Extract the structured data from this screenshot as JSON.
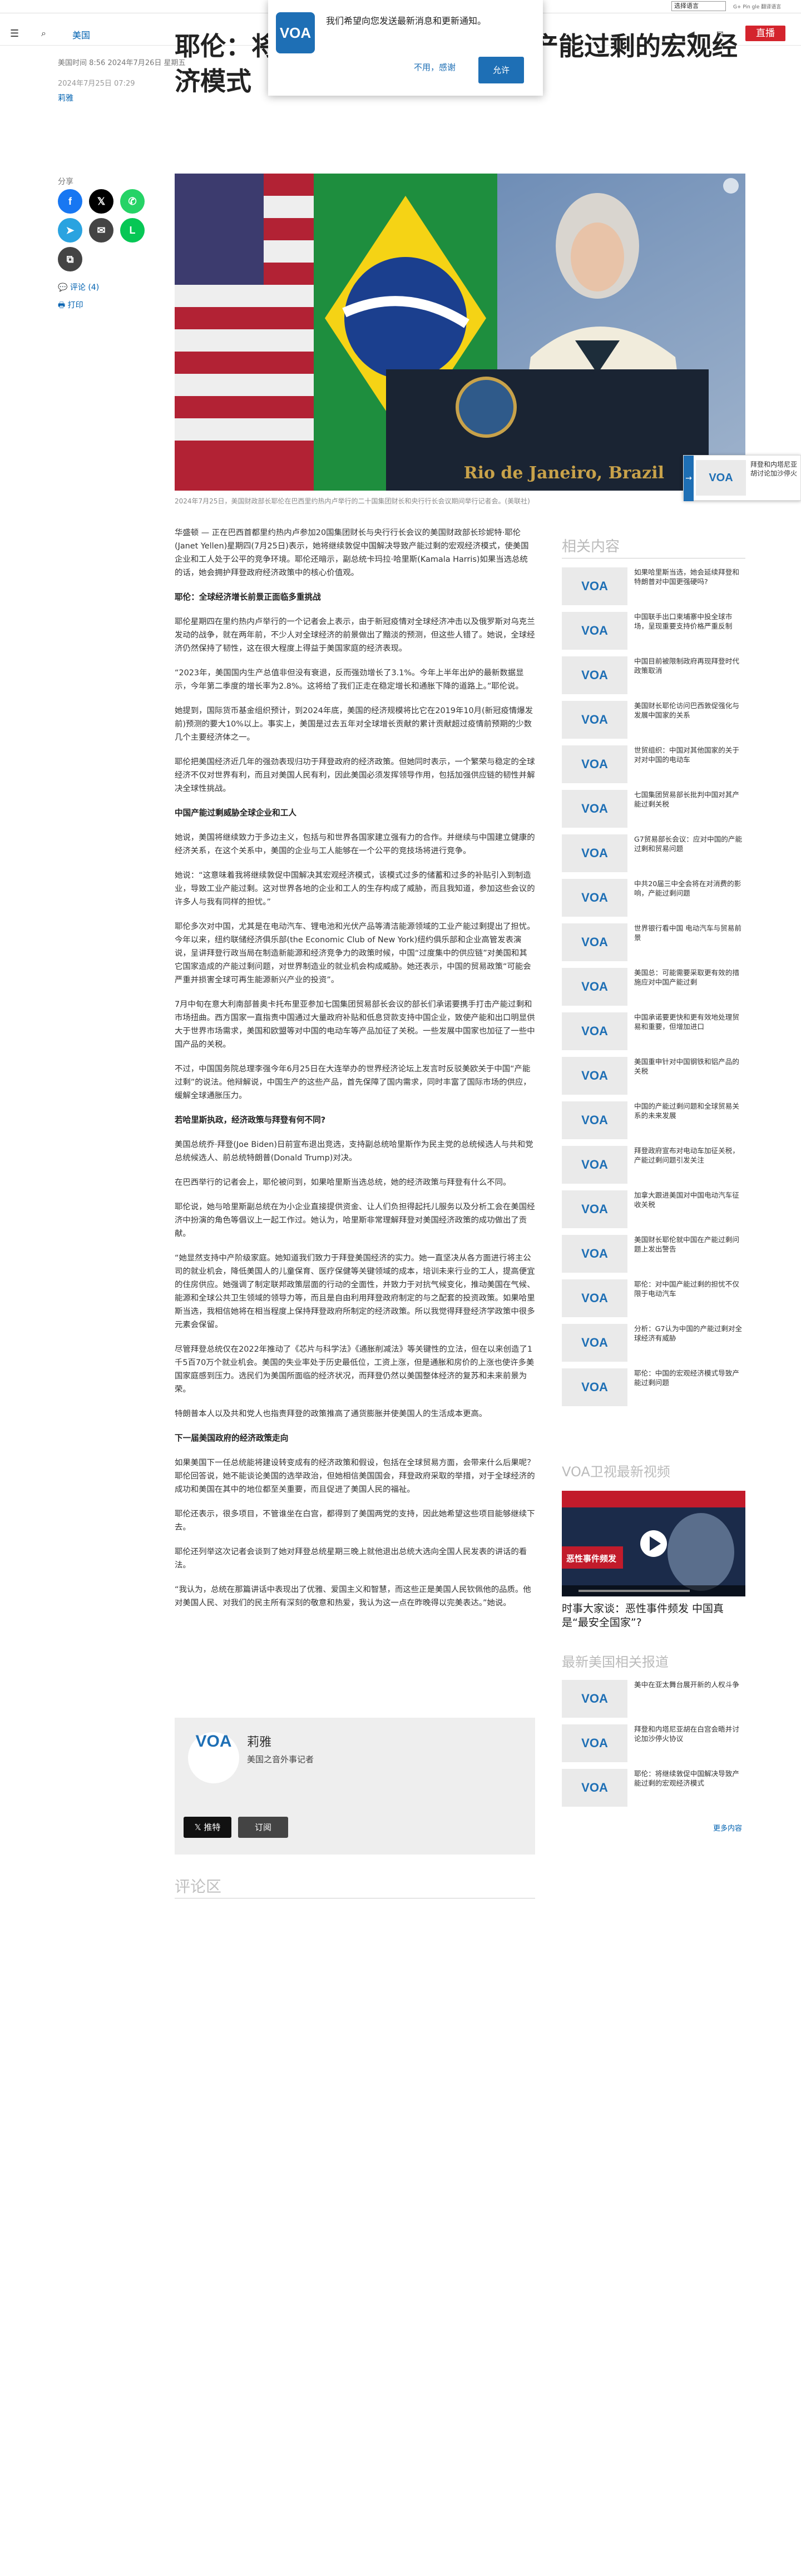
{
  "util": {
    "lang_select": "选择语言",
    "gplus_hint": "G+ Pin gle 翻译语言"
  },
  "header": {
    "section": "美国",
    "live": "直播",
    "menu_icon": "hamburger-icon",
    "search_icon": "search-icon"
  },
  "notification": {
    "logo": "VOA",
    "message": "我们希望向您发送最新消息和更新通知。",
    "decline": "不用，感谢",
    "accept": "允许"
  },
  "article": {
    "date_line": "美国时间 8:56 2024年7月26日 星期五",
    "published": "2024年7月25日 07:29",
    "author": "莉雅",
    "headline": "耶伦：将继续敦促中国解决导致产能过剩的宏观经济模式",
    "photo_text": "Rio de Janeiro, Brazil",
    "caption": "2024年7月25日，美国财政部长耶伦在巴西里约热内卢举行的二十国集团财长和央行行长会议期间举行记者会。(美联社)",
    "paragraphs": [
      {
        "type": "p",
        "text": "华盛顿 — 正在巴西首都里约热内卢参加20国集团财长与央行行长会议的美国财政部长珍妮特·耶伦(Janet Yellen)星期四(7月25日)表示，她将继续敦促中国解决导致产能过剩的宏观经济模式，使美国企业和工人处于公平的竞争环境。耶伦还暗示，副总统卡玛拉·哈里斯(Kamala Harris)如果当选总统的话，她会拥护拜登政府经济政策中的核心价值观。"
      },
      {
        "type": "h",
        "text": "耶伦：全球经济增长前景正面临多重挑战"
      },
      {
        "type": "p",
        "text": "耶伦星期四在里约热内卢举行的一个记者会上表示，由于新冠疫情对全球经济冲击以及俄罗斯对乌克兰发动的战争，就在两年前，不少人对全球经济的前景做出了黯淡的预测，但这些人错了。她说，全球经济仍然保持了韧性，这在很大程度上得益于美国家庭的经济表现。"
      },
      {
        "type": "p",
        "text": "“2023年，美国国内生产总值非但没有衰退，反而强劲增长了3.1%。今年上半年出炉的最新数据显示，今年第二季度的增长率为2.8%。这将给了我们正走在稳定增长和通胀下降的道路上。”耶伦说。"
      },
      {
        "type": "p",
        "text": "她提到，国际货币基金组织预计，到2024年底，美国的经济规模将比它在2019年10月(新冠疫情爆发前)预测的要大10%以上。事实上，美国是过去五年对全球增长贡献的累计贡献超过疫情前预期的少数几个主要经济体之一。"
      },
      {
        "type": "p",
        "text": "耶伦把美国经济近几年的强劲表现归功于拜登政府的经济政策。但她同时表示，一个繁荣与稳定的全球经济不仅对世界有利，而且对美国人民有利，因此美国必须发挥领导作用，包括加强供应链的韧性并解决全球性挑战。"
      },
      {
        "type": "h",
        "text": "中国产能过剩威胁全球企业和工人"
      },
      {
        "type": "p",
        "text": "她说，美国将继续致力于多边主义，包括与和世界各国家建立强有力的合作。并继续与中国建立健康的经济关系，在这个关系中，美国的企业与工人能够在一个公平的竞技场将进行竞争。"
      },
      {
        "type": "p",
        "text": "她说：“这意味着我将继续敦促中国解决其宏观经济模式，该模式过多的储蓄和过多的补贴引入到制造业，导致工业产能过剩。这对世界各地的企业和工人的生存构成了威胁，而且我知道，参加这些会议的许多人与我有同样的担忧。”"
      },
      {
        "type": "p",
        "text": "耶伦多次对中国，尤其是在电动汽车、锂电池和光伏产品等清洁能源领域的工业产能过剩提出了担忧。今年以来，纽约联储经济俱乐部(the Economic Club of New York)纽约俱乐部和企业高管发表演说，呈讲拜登行政当局在制造新能源和经济竞争力的政策时候，中国“过度集中的供应链”对美国和其它国家造成的产能过剩问题，对世界制造业的就业机会构成威胁。她还表示，中国的贸易政策“可能会严重并损害全球可再生能源新兴产业的投资”。"
      },
      {
        "type": "p",
        "text": "7月中旬在意大利南部普奥卡托布里亚参加七国集团贸易部长会议的部长们承诺要携手打击产能过剩和市场扭曲。西方国家一直指责中国通过大量政府补贴和低息贷款支持中国企业，致使产能和出口明显供大于世界市场需求，美国和欧盟等对中国的电动车等产品加征了关税。一些发展中国家也加征了一些中国产品的关税。"
      },
      {
        "type": "p",
        "text": "不过，中国国务院总理李强今年6月25日在大连举办的世界经济论坛上发言时反驳美欧关于中国“产能过剩”的说法。他辩解说，中国生产的这些产品，首先保障了国内需求，同时丰富了国际市场的供应，缓解全球通胀压力。"
      },
      {
        "type": "h",
        "text": "若哈里斯执政，经济政策与拜登有何不同?"
      },
      {
        "type": "p",
        "text": "美国总统乔·拜登(Joe Biden)日前宣布退出竞选，支持副总统哈里斯作为民主党的总统候选人与共和党总统候选人、前总统特朗普(Donald Trump)对决。"
      },
      {
        "type": "p",
        "text": "在巴西举行的记者会上，耶伦被问到，如果哈里斯当选总统，她的经济政策与拜登有什么不同。"
      },
      {
        "type": "p",
        "text": "耶伦说，她与哈里斯副总统在为小企业直接提供资金、让人们负担得起托儿服务以及分析工会在美国经济中扮演的角色等倡议上一起工作过。她认为，哈里斯非常理解拜登对美国经济政策的成功做出了贡献。"
      },
      {
        "type": "p",
        "text": "“她显然支持中产阶级家庭。她知道我们致力于拜登美国经济的实力。她一直坚决从各方面进行将主公司的就业机会，降低美国人的儿童保育、医疗保健等关键领域的成本，培训未来行业的工人，提高便宜的住房供应。她强调了制定联邦政策层面的行动的全面性，并致力于对抗气候变化，推动美国在气候、能源和全球公共卫生领域的领导力等，而且是自由利用拜登政府制定的与之配套的投资政策。如果哈里斯当选，我相信她将在相当程度上保持拜登政府所制定的经济政策。所以我觉得拜登经济学政策中很多元素会保留。"
      },
      {
        "type": "p",
        "text": "尽管拜登总统仅在2022年推动了《芯片与科学法》《通胀削减法》等关键性的立法，但在以来创造了1千5百70万个就业机会。美国的失业率处于历史最低位，工资上涨，但是通胀和房价的上涨也使许多美国家庭感到压力。选民们为美国所面临的经济状况，而拜登仍然以美国整体经济的复苏和未来前景为荣。"
      },
      {
        "type": "p",
        "text": "特朗普本人以及共和党人也指责拜登的政策推高了通货膨胀并使美国人的生活成本更高。"
      },
      {
        "type": "h",
        "text": "下一届美国政府的经济政策走向"
      },
      {
        "type": "p",
        "text": "如果美国下一任总统能将建设转变成有的经济政策和假设，包括在全球贸易方面，会带来什么后果呢？耶伦回答说，她不能谈论美国的选举政治，但她相信美国国会，拜登政府采取的举措，对于全球经济的成功和美国在其中的地位都至关重要，而且促进了美国人民的福祉。"
      },
      {
        "type": "p",
        "text": "耶伦还表示，很多项目，不管谁坐在白宫，都得到了美国两党的支持，因此她希望这些项目能够继续下去。"
      },
      {
        "type": "p",
        "text": "耶伦还列举这次记者会谈到了她对拜登总统星期三晚上就他退出总统大选向全国人民发表的讲话的看法。"
      },
      {
        "type": "p",
        "text": "“我认为，总统在那篇讲话中表现出了优雅、爱国主义和智慧，而这些正是美国人民钦佩他的品质。他对美国人民、对我们的民主所有深刻的敬意和热爱，我认为这一点在昨晚得以完美表达。”她说。"
      }
    ]
  },
  "share": {
    "label": "分享",
    "comments": "评论 (4)",
    "print": "打印"
  },
  "author_box": {
    "name": "莉雅",
    "role": "美国之音外事记者",
    "follow": "𝕏 推特",
    "rss": "订阅",
    "avatar": "VOA"
  },
  "comments": {
    "title": "评论区"
  },
  "related": {
    "title": "相关内容",
    "items": [
      "如果哈里斯当选，她会延续拜登和特朗普对中国更强硬吗?",
      "中国联手出口柬埔寨中投全球市场，呈现重要支持价格严重反制",
      "中国目前被限制政府再现拜登时代政策取消",
      "美国财长耶伦访问巴西敦促强化与发展中国家的关系",
      "世贸组织：中国对其他国家的关于对对中国的电动车",
      "七国集团贸易部长批判中国对其产能过剩关税",
      "G7贸易部长会议：应对中国的产能过剩和贸易问题",
      "中共20届三中全会将在对消费的影响，产能过剩问题",
      "世界银行看中国 电动汽车与贸易前景",
      "美国总：可能需要采取更有效的措施应对中国产能过剩",
      "中国承诺要更快和更有效地处理贸易和重要，但增加进口",
      "美国重申针对中国钢铁和铝产品的关税",
      "中国的产能过剩问题和全球贸易关系的未来发展",
      "拜登政府宣布对电动车加征关税，产能过剩问题引发关注",
      "加拿大跟进美国对中国电动汽车征收关税",
      "美国财长耶伦就中国在产能过剩问题上发出警告",
      "耶伦：对中国产能过剩的担忧不仅限于电动汽车",
      "分析：G7认为中国的产能过剩对全球经济有威胁",
      "耶伦：中国的宏观经济模式导致产能过剩问题"
    ]
  },
  "video": {
    "title": "VOA卫视最新视频",
    "caption": "时事大家谈：恶性事件频发 中国真是“最安全国家”?",
    "thumb_text": "恶性事件频发",
    "play_icon": "play-icon"
  },
  "latest": {
    "title": "最新美国相关报道",
    "items": [
      "美中在亚太舞台展开新的人权斗争",
      "拜登和内塔尼亚胡在白宫会晤并讨论加沙停火协议",
      "耶伦：将继续敦促中国解决导致产能过剩的宏观经济模式"
    ],
    "more": "更多内容"
  },
  "side_panel": {
    "title": "拜登和内塔尼亚胡讨论加沙停火",
    "arrow": "→"
  }
}
